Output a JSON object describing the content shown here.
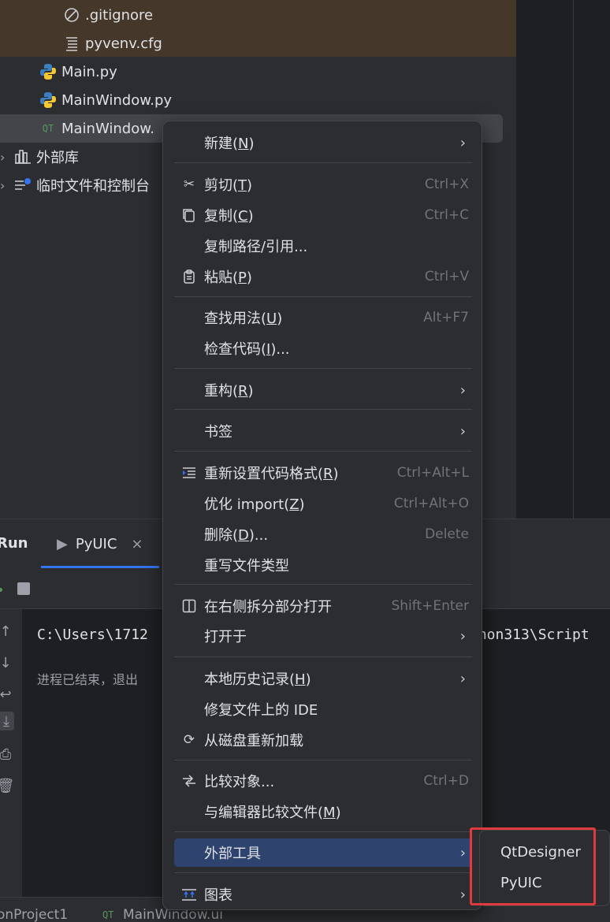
{
  "project_tree": {
    "items": [
      {
        "label": ".gitignore",
        "icon": "ignore-file-icon"
      },
      {
        "label": "pyvenv.cfg",
        "icon": "config-file-icon"
      },
      {
        "label": "Main.py",
        "icon": "python-file-icon"
      },
      {
        "label": "MainWindow.py",
        "icon": "python-file-icon"
      },
      {
        "label": "MainWindow.",
        "icon": "qt-file-icon"
      },
      {
        "label": "外部库",
        "icon": "library-icon"
      },
      {
        "label": "临时文件和控制台",
        "icon": "scratches-icon"
      }
    ]
  },
  "run_window": {
    "title": "Run",
    "tab_label": "PyUIC",
    "console_line1_left": "C:\\Users\\1712",
    "console_line1_right": "thon313\\Script",
    "console_msg": "进程已结束，退出"
  },
  "status_bar": {
    "project": "onProject1",
    "file": "MainWindow.ui"
  },
  "context_menu": {
    "items": [
      {
        "label": "新建(N)",
        "mnemonic_index": 3,
        "icon": "",
        "shortcut": "",
        "submenu": true
      },
      {
        "label": "剪切(T)",
        "mnemonic_index": 3,
        "icon": "scissors-icon",
        "shortcut": "Ctrl+X",
        "submenu": false
      },
      {
        "label": "复制(C)",
        "mnemonic_index": 3,
        "icon": "copy-icon",
        "shortcut": "Ctrl+C",
        "submenu": false
      },
      {
        "label": "复制路径/引用...",
        "icon": "",
        "shortcut": "",
        "submenu": false
      },
      {
        "label": "粘贴(P)",
        "mnemonic_index": 3,
        "icon": "paste-icon",
        "shortcut": "Ctrl+V",
        "submenu": false
      },
      {
        "label": "查找用法(U)",
        "mnemonic_index": 5,
        "icon": "",
        "shortcut": "Alt+F7",
        "submenu": false
      },
      {
        "label": "检查代码(I)...",
        "mnemonic_index": 5,
        "icon": "",
        "shortcut": "",
        "submenu": false
      },
      {
        "label": "重构(R)",
        "mnemonic_index": 3,
        "icon": "",
        "shortcut": "",
        "submenu": true
      },
      {
        "label": "书签",
        "icon": "",
        "shortcut": "",
        "submenu": true
      },
      {
        "label": "重新设置代码格式(R)",
        "mnemonic_index": 9,
        "icon": "reformat-icon",
        "shortcut": "Ctrl+Alt+L",
        "submenu": false
      },
      {
        "label": "优化 import(Z)",
        "mnemonic_index": 10,
        "icon": "",
        "shortcut": "Ctrl+Alt+O",
        "submenu": false
      },
      {
        "label": "删除(D)...",
        "mnemonic_index": 3,
        "icon": "",
        "shortcut": "Delete",
        "submenu": false
      },
      {
        "label": "重写文件类型",
        "icon": "",
        "shortcut": "",
        "submenu": false
      },
      {
        "label": "在右侧拆分部分打开",
        "icon": "split-right-icon",
        "shortcut": "Shift+Enter",
        "submenu": false
      },
      {
        "label": "打开于",
        "icon": "",
        "shortcut": "",
        "submenu": true
      },
      {
        "label": "本地历史记录(H)",
        "mnemonic_index": 7,
        "icon": "",
        "shortcut": "",
        "submenu": true
      },
      {
        "label": "修复文件上的 IDE",
        "icon": "",
        "shortcut": "",
        "submenu": false
      },
      {
        "label": "从磁盘重新加载",
        "icon": "reload-icon",
        "shortcut": "",
        "submenu": false
      },
      {
        "label": "比较对象...",
        "icon": "compare-icon",
        "shortcut": "Ctrl+D",
        "submenu": false
      },
      {
        "label": "与编辑器比较文件(M)",
        "mnemonic_index": 9,
        "icon": "",
        "shortcut": "",
        "submenu": false
      },
      {
        "label": "外部工具",
        "icon": "",
        "shortcut": "",
        "submenu": true,
        "highlighted": true
      },
      {
        "label": "图表",
        "icon": "diagram-icon",
        "shortcut": "",
        "submenu": true
      }
    ]
  },
  "external_tools_submenu": {
    "items": [
      "QtDesigner",
      "PyUIC"
    ]
  },
  "colors": {
    "highlight": "#2e436e",
    "annotation_box": "#e0393e",
    "venv_band": "#45382a"
  }
}
